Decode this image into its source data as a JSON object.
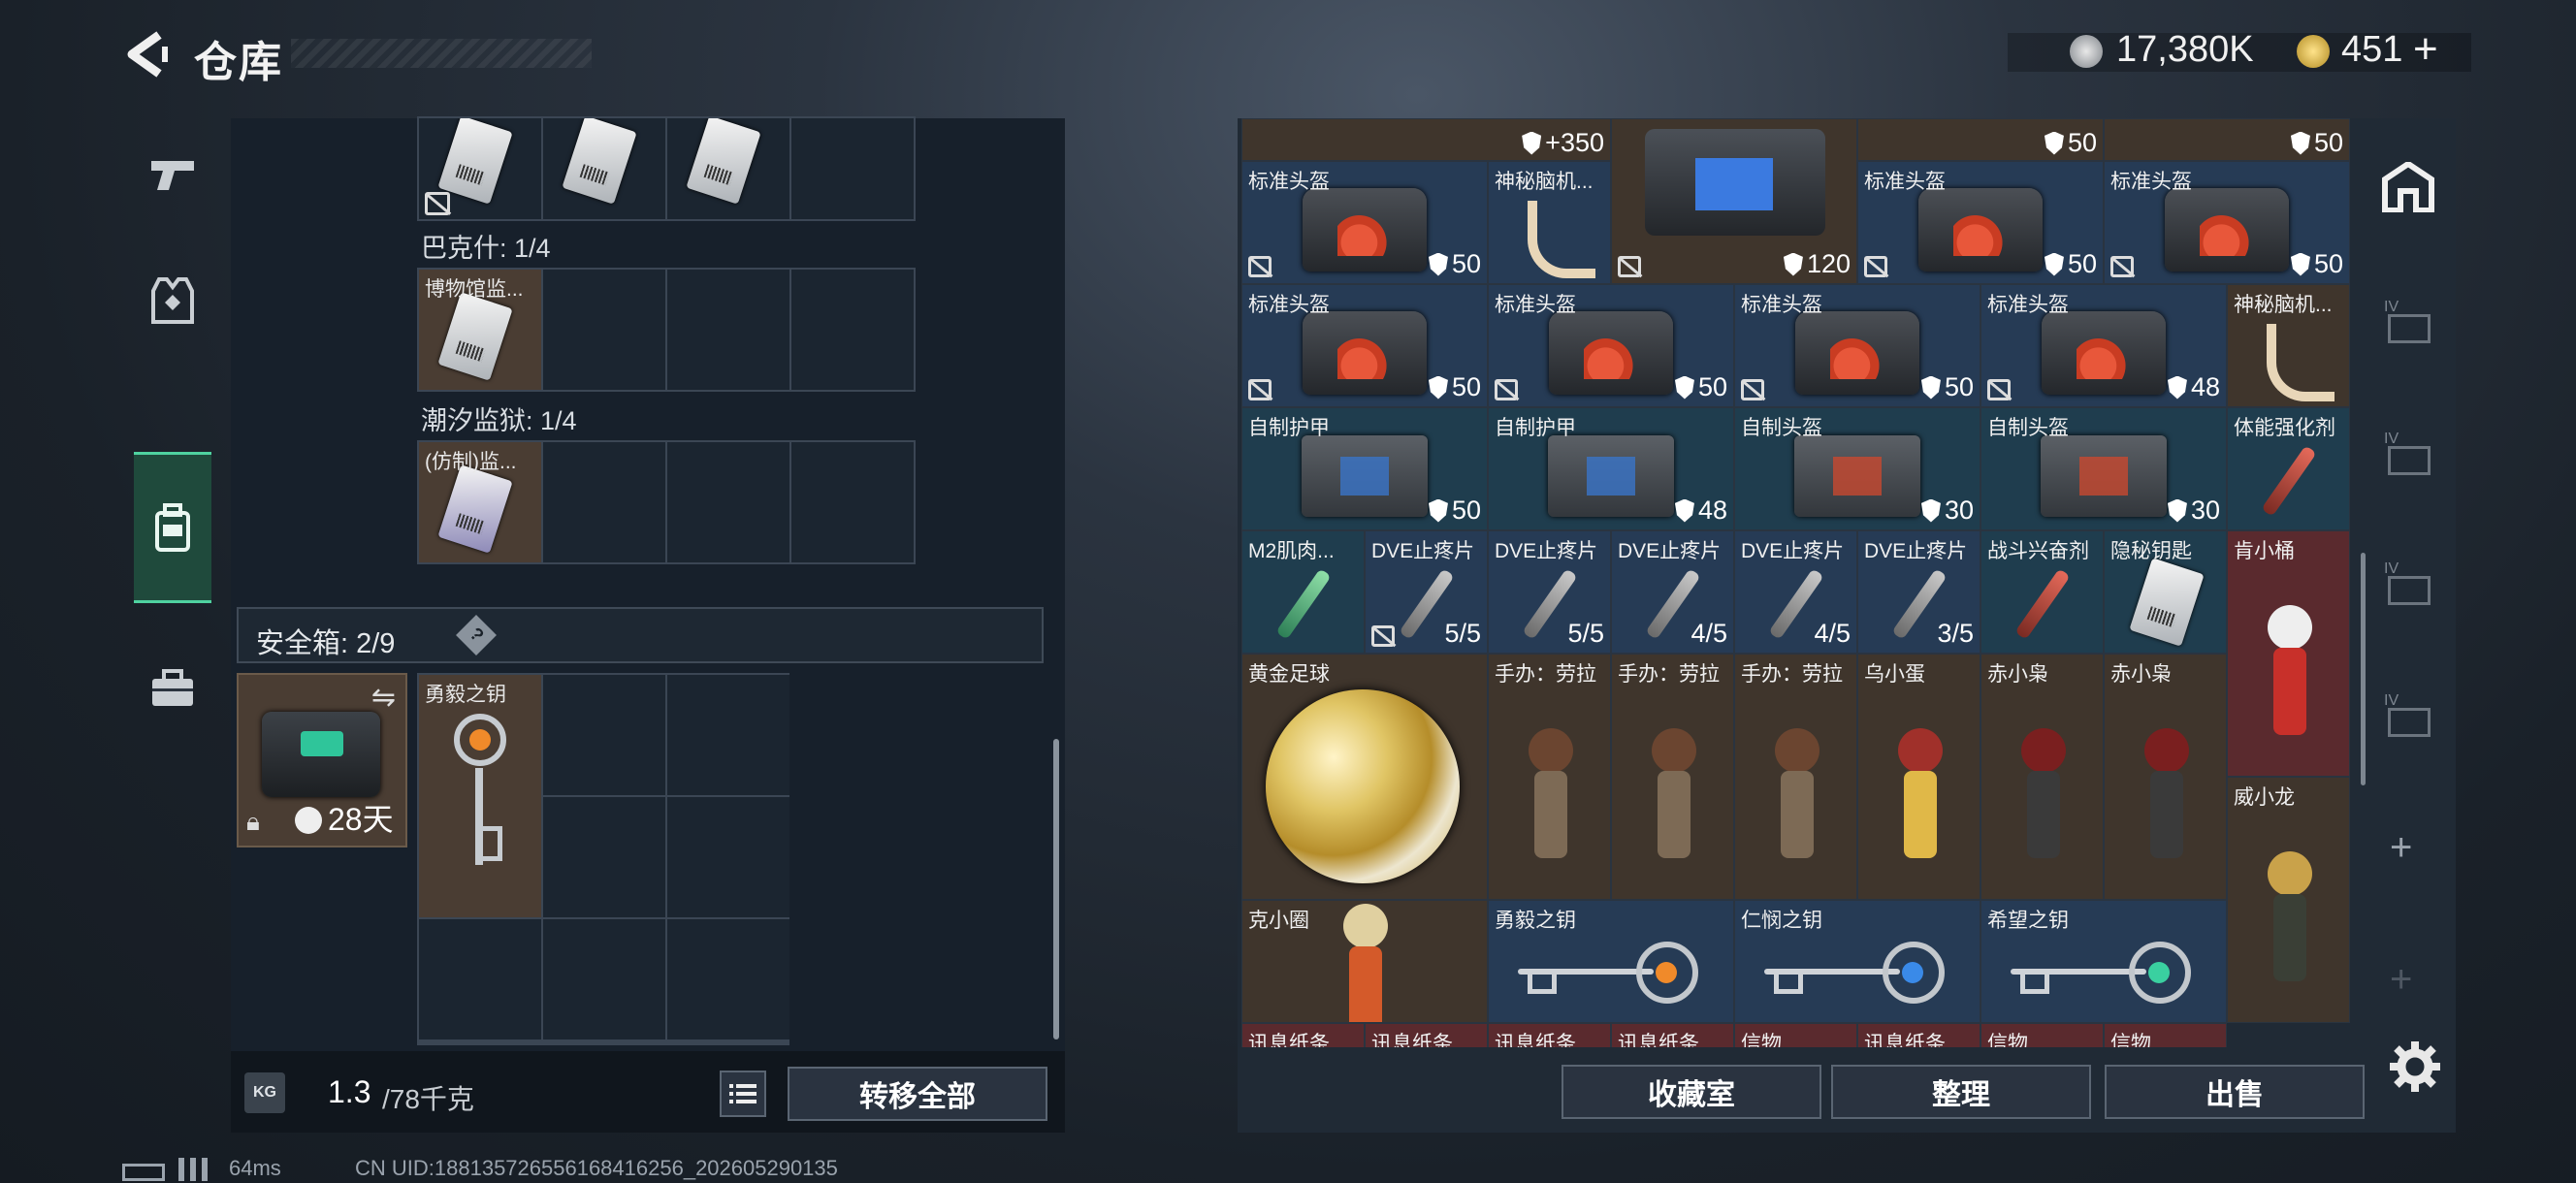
{
  "header": {
    "back_icon": "chevron-left-icon",
    "title": "仓库",
    "currency1_icon": "silver-coin-icon",
    "currency1": "17,380K",
    "currency2_icon": "gold-coin-icon",
    "currency2": "451",
    "add_label": "+"
  },
  "left_nav": {
    "items": [
      "pistol-icon",
      "vest-icon",
      "backpack-icon",
      "briefcase-icon"
    ],
    "active": 2
  },
  "left_panel": {
    "sections": [
      {
        "label": "巴克什: 1/4",
        "items": [
          {
            "name": "博物馆监..."
          }
        ]
      },
      {
        "label": "潮汐监狱: 1/4",
        "items": [
          {
            "name": "(仿制)监..."
          }
        ]
      }
    ],
    "safe_box": {
      "label": "安全箱: 2/9",
      "help": "?",
      "days": "28天",
      "key_name": "勇毅之钥"
    },
    "weight": {
      "value": "1.3",
      "unit": "/78千克",
      "badge": "KG"
    },
    "list_icon": "list-icon",
    "transfer_all": "转移全部"
  },
  "right_panel": {
    "top_partial": [
      {
        "value": "+350"
      },
      {
        "value": "50"
      },
      {
        "value": "50"
      }
    ],
    "cells": [
      {
        "name": "标准头盔",
        "value": "50",
        "kind": "helmet"
      },
      {
        "name": "神秘脑机...",
        "value": "",
        "kind": "cable"
      },
      {
        "name": "",
        "value": "120",
        "kind": "device"
      },
      {
        "name": "标准头盔",
        "value": "50",
        "kind": "helmet"
      },
      {
        "name": "标准头盔",
        "value": "50",
        "kind": "helmet"
      },
      {
        "name": "标准头盔",
        "value": "50",
        "kind": "helmet"
      },
      {
        "name": "标准头盔",
        "value": "50",
        "kind": "helmet"
      },
      {
        "name": "标准头盔",
        "value": "50",
        "kind": "helmet"
      },
      {
        "name": "标准头盔",
        "value": "48",
        "kind": "helmet"
      },
      {
        "name": "神秘脑机...",
        "value": "",
        "kind": "cable"
      },
      {
        "name": "自制护甲",
        "value": "50",
        "kind": "armor"
      },
      {
        "name": "自制护甲",
        "value": "48",
        "kind": "armor"
      },
      {
        "name": "自制头盔",
        "value": "30",
        "kind": "armor-red"
      },
      {
        "name": "自制头盔",
        "value": "30",
        "kind": "armor-red"
      },
      {
        "name": "体能强化剂",
        "value": "",
        "kind": "pill-red"
      },
      {
        "name": "M2肌肉...",
        "value": "",
        "kind": "pill-green"
      },
      {
        "name": "DVE止疼片",
        "value": "5/5",
        "kind": "pill"
      },
      {
        "name": "DVE止疼片",
        "value": "5/5",
        "kind": "pill"
      },
      {
        "name": "DVE止疼片",
        "value": "4/5",
        "kind": "pill"
      },
      {
        "name": "DVE止疼片",
        "value": "4/5",
        "kind": "pill"
      },
      {
        "name": "DVE止疼片",
        "value": "3/5",
        "kind": "pill"
      },
      {
        "name": "战斗兴奋剂",
        "value": "",
        "kind": "pill-red"
      },
      {
        "name": "隐秘钥匙",
        "value": "",
        "kind": "card"
      },
      {
        "name": "肯小桶",
        "value": "",
        "kind": "kfc"
      },
      {
        "name": "黄金足球",
        "value": "",
        "kind": "ball"
      },
      {
        "name": "手办：劳拉",
        "value": "",
        "kind": "figure"
      },
      {
        "name": "手办：劳拉",
        "value": "",
        "kind": "figure"
      },
      {
        "name": "手办：劳拉",
        "value": "",
        "kind": "figure"
      },
      {
        "name": "乌小蛋",
        "value": "",
        "kind": "egg"
      },
      {
        "name": "赤小枭",
        "value": "",
        "kind": "hood"
      },
      {
        "name": "赤小枭",
        "value": "",
        "kind": "hood"
      },
      {
        "name": "威小龙",
        "value": "",
        "kind": "soldier"
      },
      {
        "name": "克小圈",
        "value": "",
        "kind": "doll"
      },
      {
        "name": "勇毅之钥",
        "value": "",
        "kind": "key-orange"
      },
      {
        "name": "仁悯之钥",
        "value": "",
        "kind": "key-blue"
      },
      {
        "name": "希望之钥",
        "value": "",
        "kind": "key-green"
      },
      {
        "name": "讯息纸条",
        "value": "",
        "kind": "paper"
      },
      {
        "name": "讯息纸条",
        "value": "",
        "kind": "paper"
      },
      {
        "name": "讯息纸条",
        "value": "",
        "kind": "paper"
      },
      {
        "name": "讯息纸条",
        "value": "",
        "kind": "paper"
      },
      {
        "name": "信物",
        "value": "",
        "kind": "paper"
      },
      {
        "name": "讯息纸条",
        "value": "",
        "kind": "paper"
      },
      {
        "name": "信物",
        "value": "",
        "kind": "paper"
      },
      {
        "name": "信物",
        "value": "",
        "kind": "paper"
      }
    ],
    "buttons": {
      "collection": "收藏室",
      "sort": "整理",
      "sell": "出售"
    },
    "side_tabs": [
      "home-icon",
      "IV",
      "IV",
      "IV",
      "IV",
      "+",
      "+"
    ],
    "settings_icon": "gear-icon"
  },
  "footer": {
    "latency": "64ms",
    "uid": "CN UID:18813572655616841625​6_202605290135"
  },
  "colors": {
    "accent": "#4fd2a0",
    "panel": "#17202b",
    "brown": "#4a3d33",
    "blue": "#263b55",
    "red": "#5a2a2e"
  }
}
